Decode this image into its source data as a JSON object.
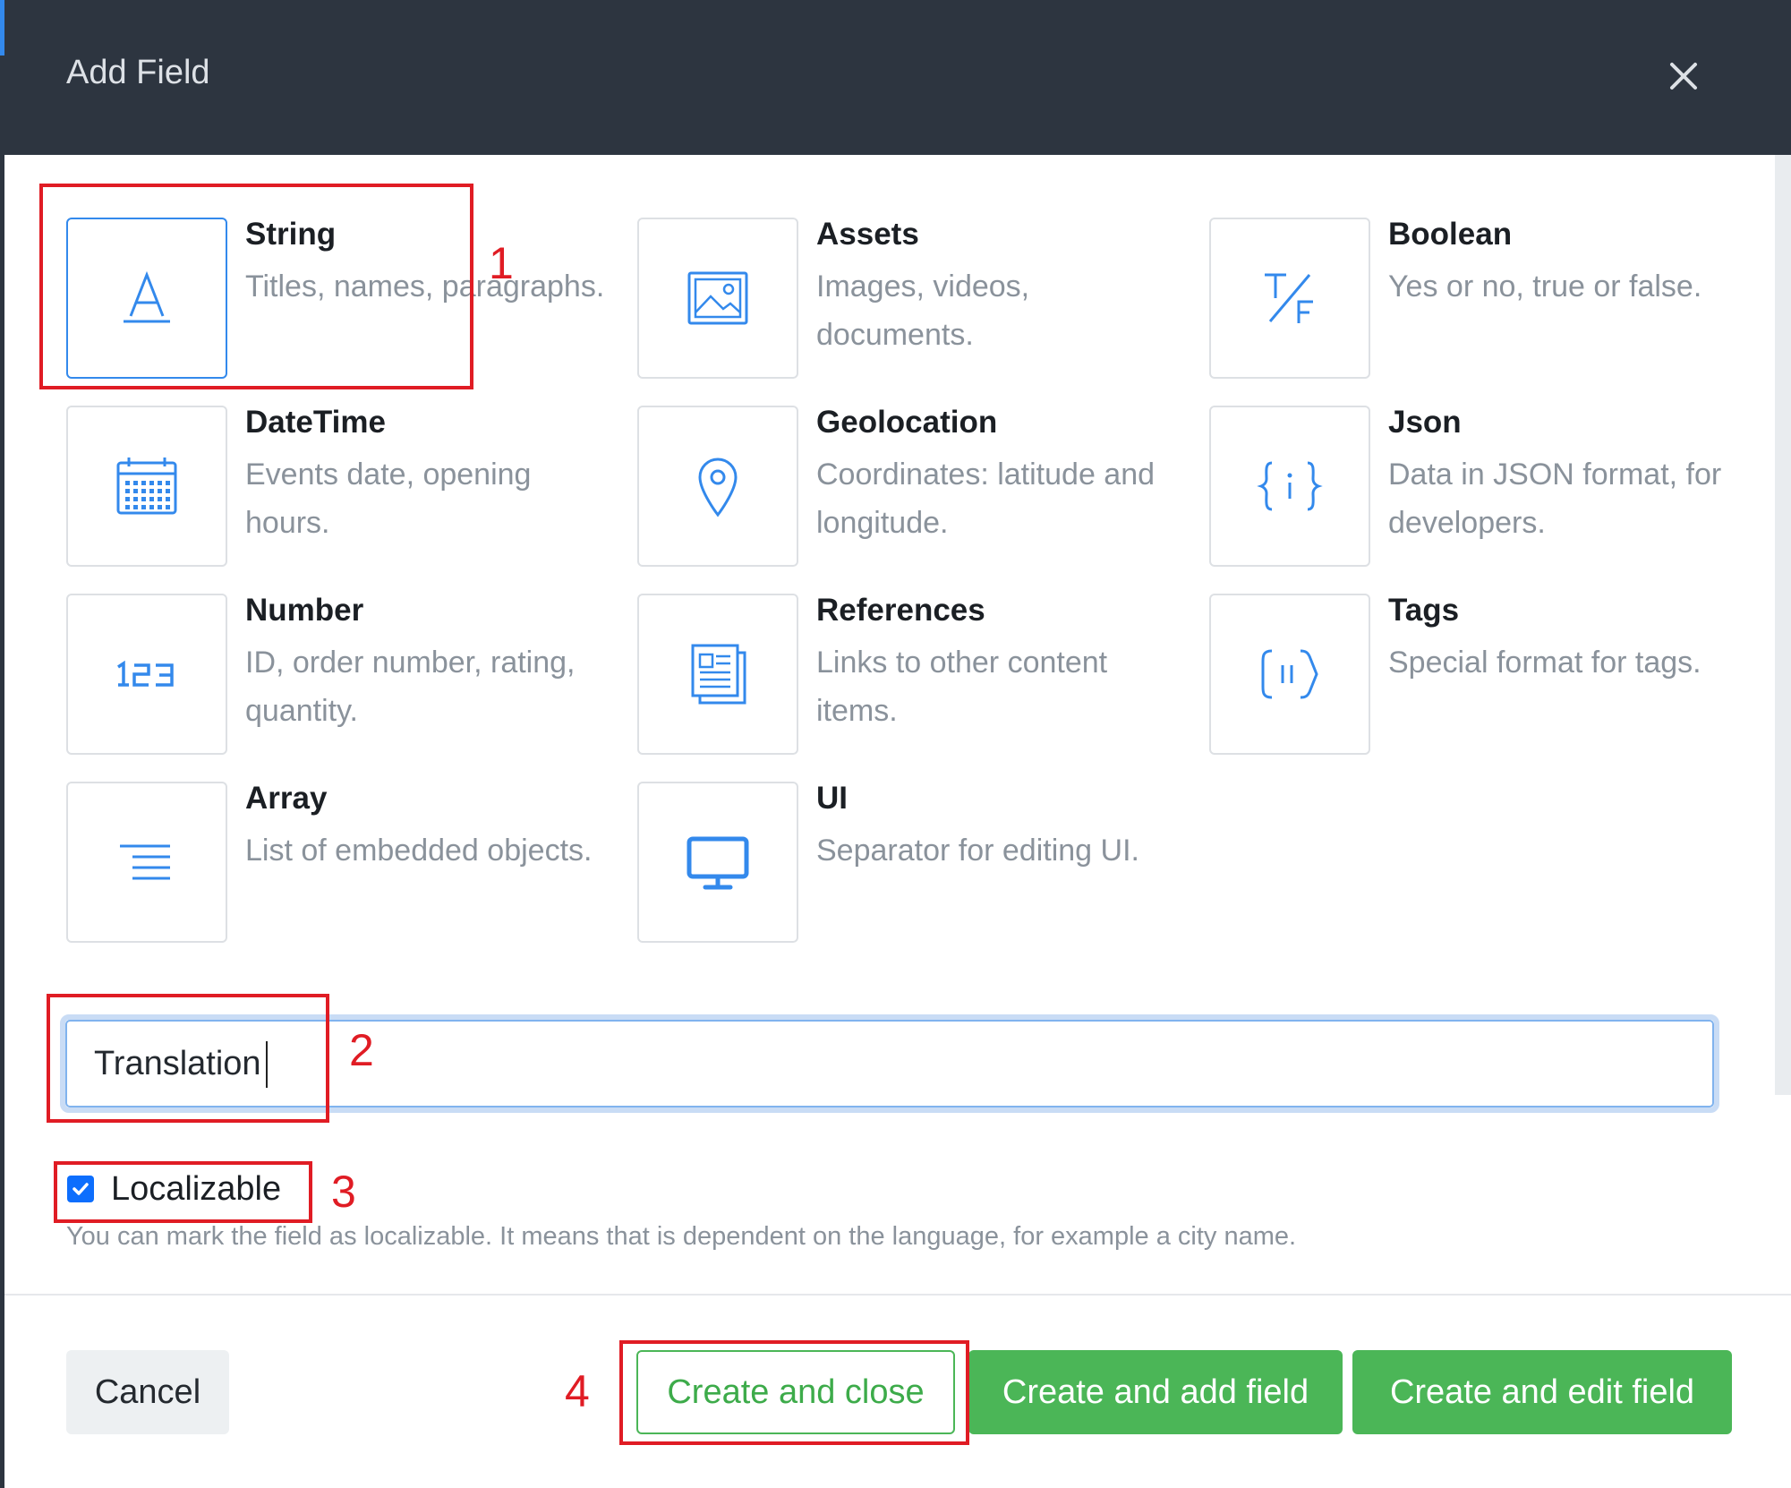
{
  "dialog": {
    "title": "Add Field",
    "close_icon": "close-icon"
  },
  "field_types": [
    {
      "name": "String",
      "description": "Titles, names, paragraphs.",
      "icon": "text-a-icon",
      "selected": true
    },
    {
      "name": "Assets",
      "description": "Images, videos, documents.",
      "icon": "image-icon",
      "selected": false
    },
    {
      "name": "Boolean",
      "description": "Yes or no, true or false.",
      "icon": "true-false-icon",
      "selected": false
    },
    {
      "name": "DateTime",
      "description": "Events date, opening hours.",
      "icon": "calendar-icon",
      "selected": false
    },
    {
      "name": "Geolocation",
      "description": "Coordinates: latitude and longitude.",
      "icon": "map-pin-icon",
      "selected": false
    },
    {
      "name": "Json",
      "description": "Data in JSON format, for developers.",
      "icon": "json-braces-icon",
      "selected": false
    },
    {
      "name": "Number",
      "description": "ID, order number, rating, quantity.",
      "icon": "number-123-icon",
      "selected": false
    },
    {
      "name": "References",
      "description": "Links to other content items.",
      "icon": "document-reference-icon",
      "selected": false
    },
    {
      "name": "Tags",
      "description": "Special format for tags.",
      "icon": "tag-icon",
      "selected": false
    },
    {
      "name": "Array",
      "description": "List of embedded objects.",
      "icon": "list-icon",
      "selected": false
    },
    {
      "name": "UI",
      "description": "Separator for editing UI.",
      "icon": "monitor-icon",
      "selected": false
    }
  ],
  "name_input": {
    "value": "Translation"
  },
  "localizable": {
    "label": "Localizable",
    "checked": true,
    "hint": "You can mark the field as localizable. It means that is dependent on the language, for example a city name."
  },
  "buttons": {
    "cancel": "Cancel",
    "create_and_close": "Create and close",
    "create_and_add": "Create and add field",
    "create_and_edit": "Create and edit field"
  },
  "annotations": [
    "1",
    "2",
    "3",
    "4"
  ],
  "colors": {
    "header_bg": "#2d3540",
    "accent_blue": "#3389ec",
    "primary_green": "#4bb657",
    "annotation_red": "#e01c24"
  }
}
